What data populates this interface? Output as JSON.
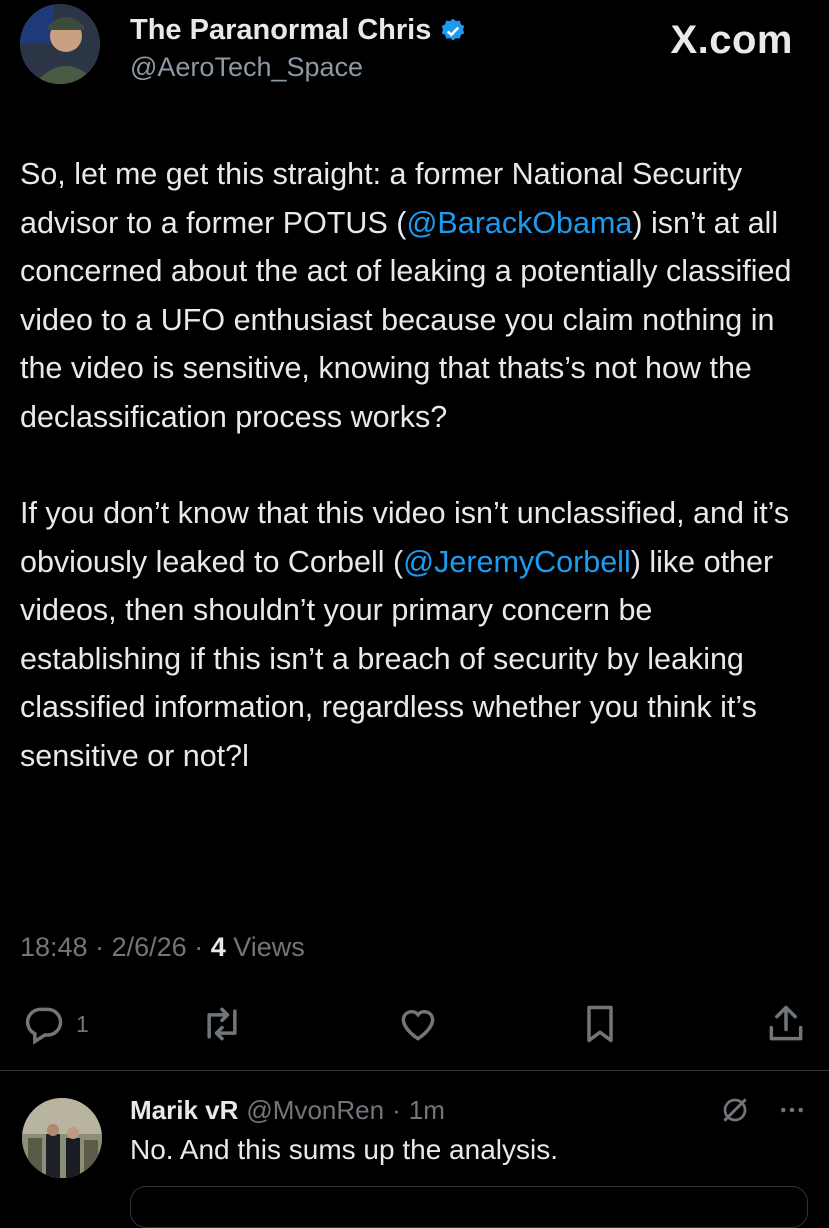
{
  "tweet": {
    "author_name": "The Paranormal Chris",
    "author_handle": "@AeroTech_Space",
    "brand": "X.com",
    "p1_a": "So, let me get this straight: a former National Security advisor to a former POTUS (",
    "mention_1": "@BarackObama",
    "p1_b": ") isn’t at all concerned about the act of leaking a potentially classified video to a UFO enthusiast because you claim nothing in the video is sensitive, knowing that thats’s not how the declassification process works?",
    "p2_a": "If you don’t know that this video isn’t unclassified, and it’s obviously leaked to Corbell (",
    "mention_2": "@JeremyCorbell",
    "p2_b": ") like other videos, then shouldn’t your primary concern be establishing if this isn’t a breach of security by leaking classified information, regardless whether you think it’s sensitive or not?l",
    "time": "18:48",
    "date": "2/6/26",
    "views_count": "4",
    "views_label": "Views",
    "reply_count": "1"
  },
  "reply": {
    "name": "Marik vR",
    "handle": "@MvonRen",
    "age": "1m",
    "text": "No. And this sums up the analysis."
  },
  "colors": {
    "background": "#000000",
    "text": "#e7e9ea",
    "secondary": "#71767b",
    "accent": "#1d9bf0"
  },
  "icons": [
    "verified-badge-icon",
    "reply-icon",
    "repost-icon",
    "like-icon",
    "bookmark-icon",
    "share-icon",
    "grok-icon",
    "more-icon"
  ]
}
